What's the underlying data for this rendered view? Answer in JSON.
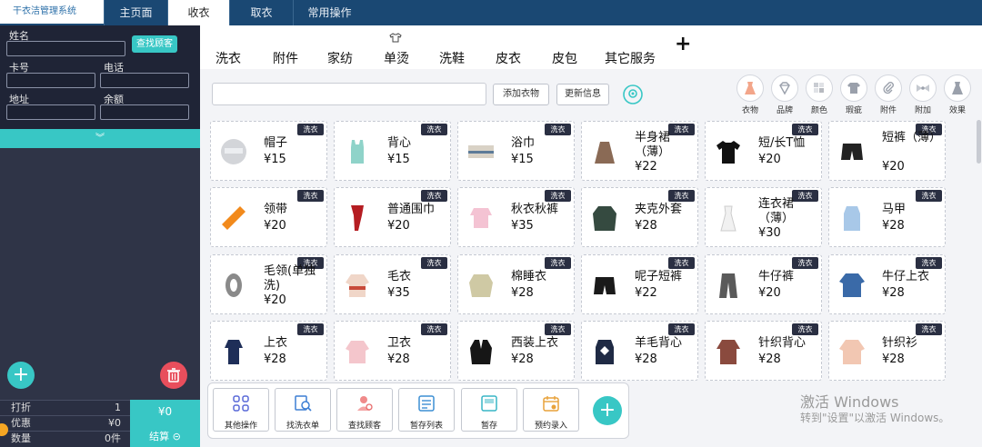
{
  "app": {
    "title": "干衣洁管理系统"
  },
  "nav": {
    "tabs": [
      "主页面",
      "收衣",
      "取衣",
      "常用操作"
    ],
    "active": "收衣"
  },
  "form": {
    "name_label": "姓名",
    "find_button": "查找顾客",
    "card_label": "卡号",
    "phone_label": "电话",
    "address_label": "地址",
    "balance_label": "余额",
    "name_value": "",
    "card_value": "",
    "phone_value": "",
    "address_value": "",
    "balance_value": "",
    "expand_icon": "chevron-double-down"
  },
  "categories": [
    "洗衣",
    "附件",
    "家纺",
    "单烫",
    "洗鞋",
    "皮衣",
    "皮包",
    "其它服务",
    "+"
  ],
  "toolbar": {
    "search_value": "",
    "add_clothes": "添加衣物",
    "refresh": "更新信息"
  },
  "attributes": [
    "衣物",
    "品牌",
    "颜色",
    "瑕疵",
    "附件",
    "附加",
    "效果"
  ],
  "items": [
    {
      "name": "帽子",
      "price": "¥15",
      "tag": "洗衣"
    },
    {
      "name": "背心",
      "price": "¥15",
      "tag": "洗衣"
    },
    {
      "name": "浴巾",
      "price": "¥15",
      "tag": "洗衣"
    },
    {
      "name": "半身裙（薄）",
      "price": "¥22",
      "tag": "洗衣"
    },
    {
      "name": "短/长T恤",
      "price": "¥20",
      "tag": "洗衣"
    },
    {
      "name": "短裤（薄）",
      "price": "¥20",
      "tag": "洗衣"
    },
    {
      "name": "领带",
      "price": "¥20",
      "tag": "洗衣"
    },
    {
      "name": "普通围巾",
      "price": "¥20",
      "tag": "洗衣"
    },
    {
      "name": "秋衣秋裤",
      "price": "¥35",
      "tag": "洗衣"
    },
    {
      "name": "夹克外套",
      "price": "¥28",
      "tag": "洗衣"
    },
    {
      "name": "连衣裙（薄）",
      "price": "¥30",
      "tag": "洗衣"
    },
    {
      "name": "马甲",
      "price": "¥28",
      "tag": "洗衣"
    },
    {
      "name": "毛领(单独洗)",
      "price": "¥20",
      "tag": "洗衣"
    },
    {
      "name": "毛衣",
      "price": "¥35",
      "tag": "洗衣"
    },
    {
      "name": "棉睡衣",
      "price": "¥28",
      "tag": "洗衣"
    },
    {
      "name": "呢子短裤",
      "price": "¥22",
      "tag": "洗衣"
    },
    {
      "name": "牛仔裤",
      "price": "¥20",
      "tag": "洗衣"
    },
    {
      "name": "牛仔上衣",
      "price": "¥28",
      "tag": "洗衣"
    },
    {
      "name": "上衣",
      "price": "¥28",
      "tag": "洗衣"
    },
    {
      "name": "卫衣",
      "price": "¥28",
      "tag": "洗衣"
    },
    {
      "name": "西装上衣",
      "price": "¥28",
      "tag": "洗衣"
    },
    {
      "name": "羊毛背心",
      "price": "¥28",
      "tag": "洗衣"
    },
    {
      "name": "针织背心",
      "price": "¥28",
      "tag": "洗衣"
    },
    {
      "name": "针织衫",
      "price": "¥28",
      "tag": "洗衣"
    }
  ],
  "actions": [
    "其他操作",
    "找洗衣单",
    "查找顾客",
    "暂存列表",
    "暂存",
    "预约录入"
  ],
  "summary": {
    "discount_label": "打折",
    "discount_value": "1",
    "promo_label": "优惠",
    "promo_value": "¥0",
    "count_label": "数量",
    "count_value": "0件",
    "total": "¥0",
    "settle_label": "结算"
  },
  "watermark": {
    "line1": "激活 Windows",
    "line2": "转到\"设置\"以激活 Windows。"
  },
  "colors": {
    "nav": "#1a4873",
    "accent": "#38c7c5",
    "sidebar": "#2f3447",
    "danger": "#e84e5c"
  }
}
